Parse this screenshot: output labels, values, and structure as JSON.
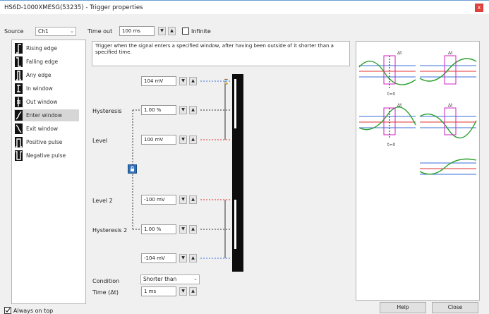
{
  "window": {
    "title": "HS6D-1000XMESG(53235) - Trigger properties",
    "close_glyph": "x"
  },
  "top": {
    "source_label": "Source",
    "source_value": "Ch1",
    "timeout_label": "Time out",
    "timeout_value": "100 ms",
    "infinite_label": "Infinite"
  },
  "trigger_kinds": [
    {
      "label": "Rising edge",
      "icon": "rising-edge-icon"
    },
    {
      "label": "Falling edge",
      "icon": "falling-edge-icon"
    },
    {
      "label": "Any edge",
      "icon": "any-edge-icon"
    },
    {
      "label": "In window",
      "icon": "in-window-icon"
    },
    {
      "label": "Out window",
      "icon": "out-window-icon"
    },
    {
      "label": "Enter window",
      "icon": "enter-window-icon"
    },
    {
      "label": "Exit window",
      "icon": "exit-window-icon"
    },
    {
      "label": "Positive pulse",
      "icon": "positive-pulse-icon"
    },
    {
      "label": "Negative pulse",
      "icon": "negative-pulse-icon"
    }
  ],
  "selected_kind_index": 5,
  "description": "Trigger when the signal enters a specified window, after having been outside of it shorter than a specified time.",
  "params": {
    "upper_value": "104 mV",
    "hysteresis_label": "Hysteresis",
    "hysteresis_value": "1.00 %",
    "level_label": "Level",
    "level_value": "100 mV",
    "level2_label": "Level 2",
    "level2_value": "-100 mV",
    "hysteresis2_label": "Hysteresis 2",
    "hysteresis2_value": "1.00 %",
    "lower_value": "-104 mV",
    "condition_label": "Condition",
    "condition_value": "Shorter than",
    "time_label": "Time (Δt)",
    "time_value": "1 ms"
  },
  "spin_glyphs": {
    "down": "▼",
    "up": "▲"
  },
  "preview": {
    "delta_label": "Δt",
    "t0_label": "t=0"
  },
  "footer": {
    "always_on_top": "Always on top",
    "help": "Help",
    "close": "Close"
  },
  "colors": {
    "title_accent": "#6a9fd4",
    "close_red": "#e0403a",
    "level_red": "#e03030",
    "hyst_blue": "#3a6fd8",
    "signal_green": "#2aa02a",
    "window_magenta": "#d020c0"
  }
}
